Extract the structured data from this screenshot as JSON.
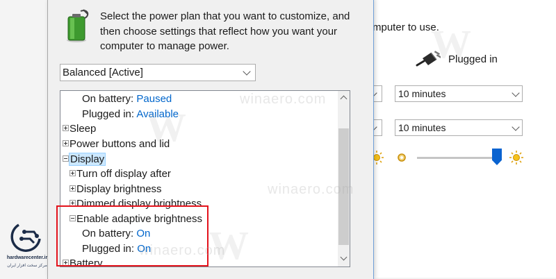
{
  "background_window": {
    "description_partial": "mputer to use.",
    "plugged_in_label": "Plugged in",
    "sleep_display_selects": [
      "10 minutes",
      "10 minutes"
    ]
  },
  "dialog": {
    "intro_text": "Select the power plan that you want to customize, and then choose settings that reflect how you want your computer to manage power.",
    "plan_select_value": "Balanced [Active]",
    "tree": [
      {
        "label": "On battery:",
        "value": "Paused"
      },
      {
        "label": "Plugged in:",
        "value": "Available"
      },
      {
        "label": "Sleep",
        "expander": "plus"
      },
      {
        "label": "Power buttons and lid",
        "expander": "plus"
      },
      {
        "label": "Display",
        "expander": "minus",
        "selected": true
      },
      {
        "label": "Turn off display after",
        "expander": "plus"
      },
      {
        "label": "Display brightness",
        "expander": "plus"
      },
      {
        "label": "Dimmed display brightness",
        "expander": "plus"
      },
      {
        "label": "Enable adaptive brightness",
        "expander": "minus"
      },
      {
        "label": "On battery:",
        "value": "On"
      },
      {
        "label": "Plugged in:",
        "value": "On"
      },
      {
        "label": "Battery",
        "expander": "plus"
      }
    ]
  },
  "watermark": "winaero.com",
  "logo": {
    "name": "hardwarecenter.ir",
    "subtitle": "مرکز سخت افزار ایران"
  },
  "colors": {
    "link_blue": "#0066cc",
    "highlight_red": "#e3121b",
    "selection_bg": "#cce8ff",
    "slider_blue": "#0a63d0"
  },
  "icons": {
    "battery": "battery-icon",
    "plug": "power-plug-icon",
    "sun_dim": "sun-dim-icon",
    "sun_bright": "sun-bright-icon"
  }
}
